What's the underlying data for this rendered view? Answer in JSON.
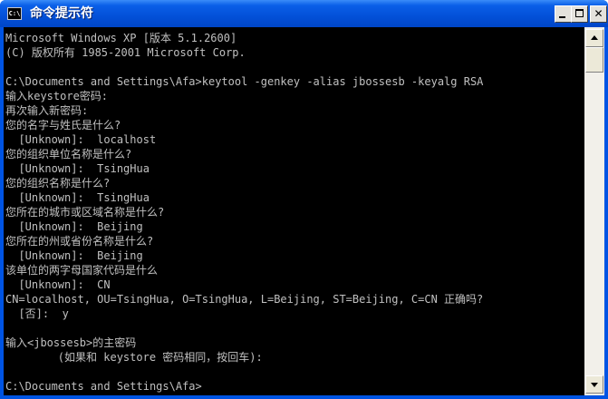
{
  "window": {
    "title": "命令提示符",
    "icon_label": "C:\\",
    "icon": "cmd-icon",
    "buttons": [
      "minimize-icon",
      "maximize-icon",
      "close-icon"
    ],
    "close_glyph": "✕"
  },
  "console": {
    "lines": [
      "Microsoft Windows XP [版本 5.1.2600]",
      "(C) 版权所有 1985-2001 Microsoft Corp.",
      "",
      "C:\\Documents and Settings\\Afa>keytool -genkey -alias jbossesb -keyalg RSA",
      "输入keystore密码:",
      "再次输入新密码:",
      "您的名字与姓氏是什么?",
      "  [Unknown]:  localhost",
      "您的组织单位名称是什么?",
      "  [Unknown]:  TsingHua",
      "您的组织名称是什么?",
      "  [Unknown]:  TsingHua",
      "您所在的城市或区域名称是什么?",
      "  [Unknown]:  Beijing",
      "您所在的州或省份名称是什么?",
      "  [Unknown]:  Beijing",
      "该单位的两字母国家代码是什么",
      "  [Unknown]:  CN",
      "CN=localhost, OU=TsingHua, O=TsingHua, L=Beijing, ST=Beijing, C=CN 正确吗?",
      "  [否]:  y",
      "",
      "输入<jbossesb>的主密码",
      "        (如果和 keystore 密码相同，按回车):",
      "",
      "C:\\Documents and Settings\\Afa>"
    ]
  },
  "colors": {
    "console_bg": "#000000",
    "console_fg": "#c0c0c0",
    "titlebar": "#0054e3"
  }
}
